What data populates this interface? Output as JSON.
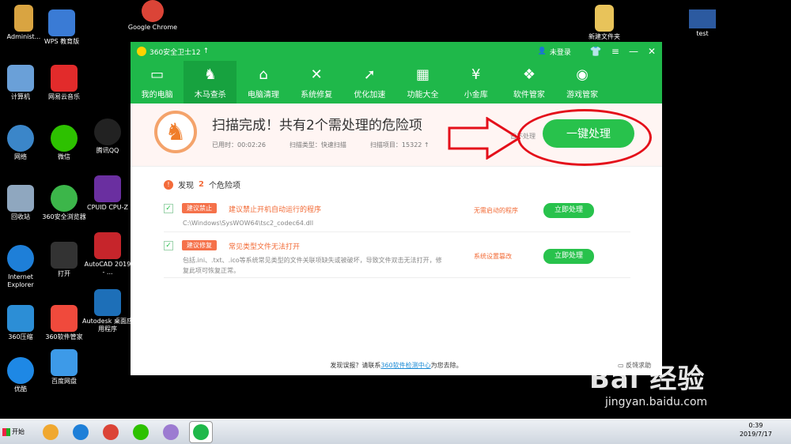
{
  "desktop": {
    "icons": [
      {
        "label": "Administ...",
        "color": "#d9a441"
      },
      {
        "label": "WPS 教育版",
        "color": "#3a7bd5"
      },
      {
        "label": "Google Chrome",
        "color": "#db4437"
      },
      {
        "label": "计算机",
        "color": "#6aa0d8"
      },
      {
        "label": "网易云音乐",
        "color": "#e22b2b"
      },
      {
        "label": "网络",
        "color": "#3b86c9"
      },
      {
        "label": "微信",
        "color": "#2dc100"
      },
      {
        "label": "腾讯QQ",
        "color": "#222222"
      },
      {
        "label": "回收站",
        "color": "#8fa7bf"
      },
      {
        "label": "360安全浏览器",
        "color": "#3cb64a"
      },
      {
        "label": "CPUID CPU-Z",
        "color": "#6a2fa0"
      },
      {
        "label": "Internet Explorer",
        "color": "#1e7fd8"
      },
      {
        "label": "打开",
        "color": "#333333"
      },
      {
        "label": "AutoCAD 2019 - ...",
        "color": "#c6252b"
      },
      {
        "label": "360压缩",
        "color": "#2c8ed6"
      },
      {
        "label": "360软件管家",
        "color": "#f04a3c"
      },
      {
        "label": "Autodesk 桌面应用程序",
        "color": "#1d6fb8"
      },
      {
        "label": "优酷",
        "color": "#1e88e5"
      },
      {
        "label": "百度网盘",
        "color": "#3d9ae8"
      },
      {
        "label": "新建文件夹",
        "color": "#e8c35a"
      },
      {
        "label": "test",
        "color": "#2c5aa0"
      }
    ]
  },
  "window": {
    "app_title": "360安全卫士12",
    "login_label": "未登录",
    "tabs": [
      {
        "label": "我的电脑",
        "icon": "monitor-icon",
        "glyph": "▭"
      },
      {
        "label": "木马查杀",
        "icon": "horse-icon",
        "glyph": "♞"
      },
      {
        "label": "电脑清理",
        "icon": "broom-icon",
        "glyph": "⌂"
      },
      {
        "label": "系统修复",
        "icon": "tools-icon",
        "glyph": "✕"
      },
      {
        "label": "优化加速",
        "icon": "rocket-icon",
        "glyph": "➚"
      },
      {
        "label": "功能大全",
        "icon": "grid-icon",
        "glyph": "▦"
      },
      {
        "label": "小金库",
        "icon": "coin-icon",
        "glyph": "¥"
      },
      {
        "label": "软件管家",
        "icon": "apps-icon",
        "glyph": "❖"
      },
      {
        "label": "游戏管家",
        "icon": "gamepad-icon",
        "glyph": "◉"
      }
    ],
    "active_tab": 1,
    "banner": {
      "headline": "扫描完成！共有2个需处理的危险项",
      "elapsed": "已用时：00:02:26",
      "scan_type": "扫描类型：快速扫描",
      "scan_items": "扫描项目：15322 ↑",
      "skip_label": "暂不处理",
      "fix_all_label": "一键处理"
    },
    "found": {
      "prefix": "发现",
      "count": "2",
      "suffix": "个危险项"
    },
    "risks": [
      {
        "tag": "建议禁止",
        "title": "建议禁止开机自动运行的程序",
        "detail": "C:\\Windows\\SysWOW64\\tsc2_codec64.dll",
        "status": "无需启动的程序",
        "action": "立即处理"
      },
      {
        "tag": "建议修复",
        "title": "常见类型文件无法打开",
        "detail": "包括.ini、.txt、.ico等系统常见类型的文件关联项缺失或被破坏，导致文件双击无法打开，修复此项可恢复正常。",
        "status": "系统设置篡改",
        "action": "立即处理"
      }
    ],
    "footer": {
      "prefix": "发现误报？请联系",
      "link": "360软件检测中心",
      "suffix": "为您去除。"
    },
    "feedback_label": "反馈求助"
  },
  "taskbar": {
    "start_label": "开始",
    "time": "0:39",
    "date": "2019/7/17"
  },
  "watermark": {
    "brand": "Bai 经验",
    "url": "jingyan.baidu.com"
  },
  "colors": {
    "brand_green": "#1fb84a",
    "danger_orange": "#f26a35",
    "annotation_red": "#e40f1a"
  }
}
